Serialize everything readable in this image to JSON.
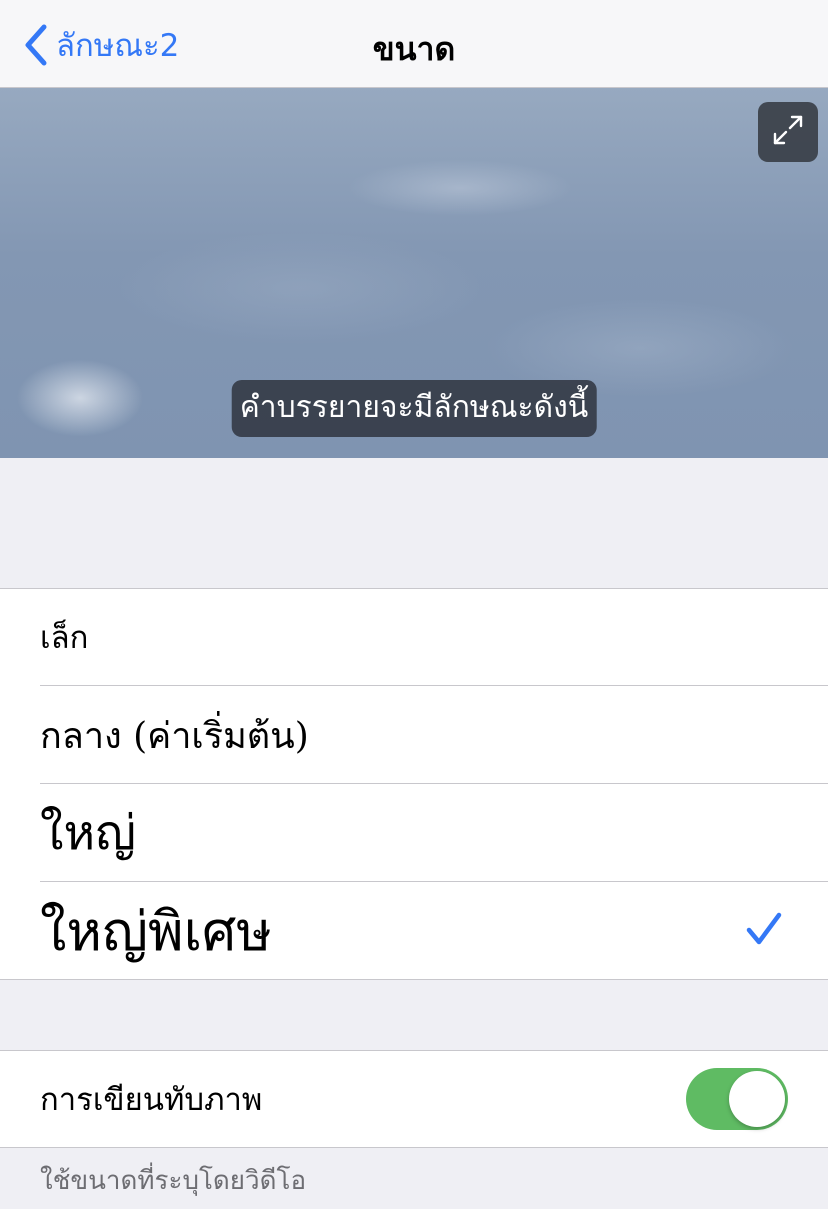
{
  "navbar": {
    "back_label": "ลักษณะ2",
    "title": "ขนาด"
  },
  "preview": {
    "caption": "คำบรรยายจะมีลักษณะดังนี้"
  },
  "sizes": {
    "items": [
      {
        "label": "เล็ก",
        "selected": false
      },
      {
        "label": "กลาง (ค่าเริ่มต้น)",
        "selected": false
      },
      {
        "label": "ใหญ่",
        "selected": false
      },
      {
        "label": "ใหญ่พิเศษ",
        "selected": true
      }
    ]
  },
  "override": {
    "label": "การเขียนทับภาพ",
    "enabled": true,
    "footer": "ใช้ขนาดที่ระบุโดยวิดีโอ"
  },
  "colors": {
    "accent": "#3478f6",
    "toggle_on": "#5fbb63"
  },
  "icons": {
    "back": "chevron-left-icon",
    "expand": "expand-icon",
    "check": "checkmark-icon"
  }
}
